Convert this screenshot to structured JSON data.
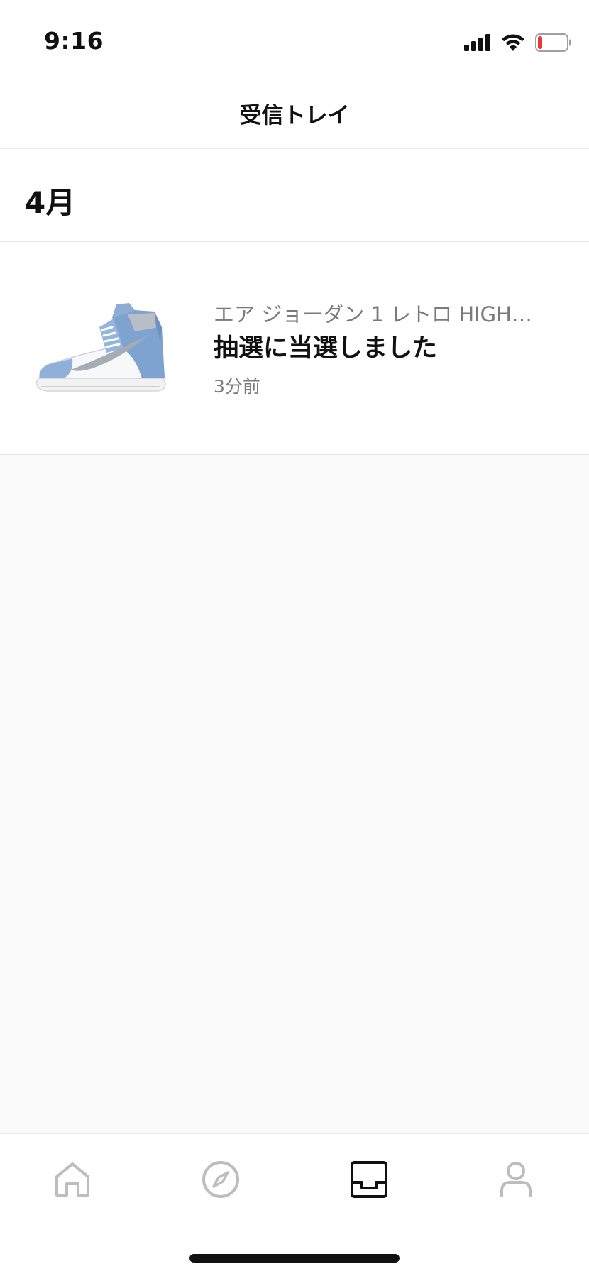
{
  "status_bar": {
    "time": "9:16",
    "icons": [
      "cellular-signal-icon",
      "wifi-icon",
      "battery-low-icon"
    ],
    "battery_color": "#e53935"
  },
  "header": {
    "title": "受信トレイ"
  },
  "section": {
    "title": "4月"
  },
  "inbox": {
    "items": [
      {
        "thumbnail_icon": "sneaker-thumbnail",
        "subtitle": "エア ジョーダン 1 レトロ HIGH…",
        "title": "抽選に当選しました",
        "time": "3分前"
      }
    ]
  },
  "tab_bar": {
    "tabs": [
      {
        "icon": "home-icon",
        "active": false
      },
      {
        "icon": "compass-icon",
        "active": false
      },
      {
        "icon": "inbox-icon",
        "active": true
      },
      {
        "icon": "profile-icon",
        "active": false
      }
    ],
    "active_color": "#111111",
    "inactive_color": "#bdbdbd"
  }
}
